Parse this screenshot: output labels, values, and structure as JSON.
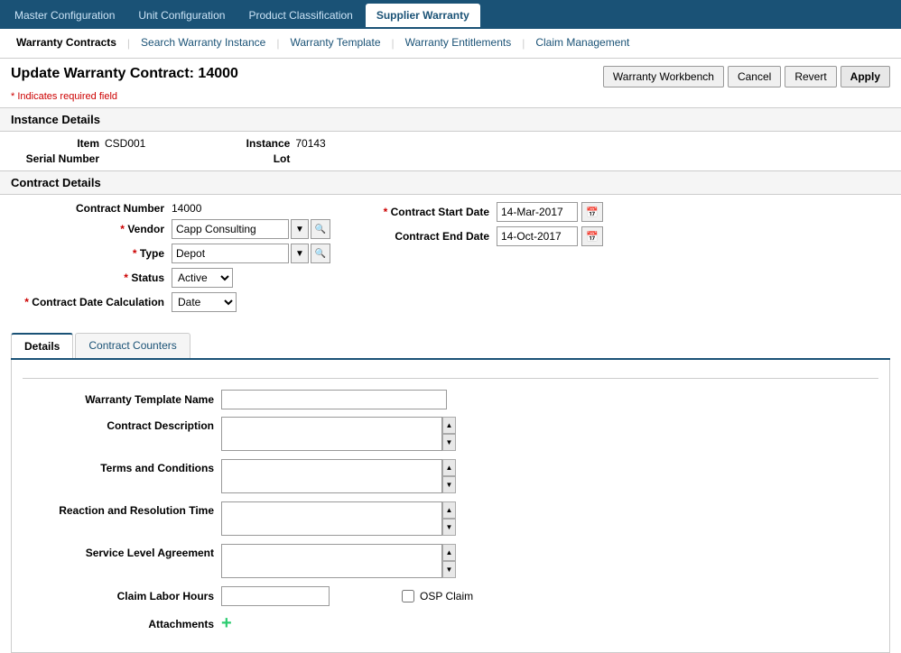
{
  "topNav": {
    "tabs": [
      {
        "id": "master-config",
        "label": "Master Configuration",
        "active": false
      },
      {
        "id": "unit-config",
        "label": "Unit Configuration",
        "active": false
      },
      {
        "id": "product-class",
        "label": "Product Classification",
        "active": false
      },
      {
        "id": "supplier-warranty",
        "label": "Supplier Warranty",
        "active": true
      }
    ]
  },
  "secondNav": {
    "items": [
      {
        "id": "warranty-contracts",
        "label": "Warranty Contracts",
        "active": true
      },
      {
        "id": "search-warranty",
        "label": "Search Warranty Instance",
        "active": false
      },
      {
        "id": "warranty-template",
        "label": "Warranty Template",
        "active": false
      },
      {
        "id": "warranty-entitlements",
        "label": "Warranty Entitlements",
        "active": false
      },
      {
        "id": "claim-management",
        "label": "Claim Management",
        "active": false
      }
    ]
  },
  "pageTitle": "Update Warranty Contract: 14000",
  "requiredNote": "* Indicates required field",
  "actionButtons": {
    "warrantyWorkbench": "Warranty Workbench",
    "cancel": "Cancel",
    "revert": "Revert",
    "apply": "Apply"
  },
  "instanceDetails": {
    "sectionTitle": "Instance Details",
    "item": {
      "label": "Item",
      "value": "CSD001"
    },
    "serialNumber": {
      "label": "Serial Number",
      "value": ""
    },
    "instance": {
      "label": "Instance",
      "value": "70143"
    },
    "lot": {
      "label": "Lot",
      "value": ""
    }
  },
  "contractDetails": {
    "sectionTitle": "Contract Details",
    "contractNumber": {
      "label": "Contract Number",
      "value": "14000"
    },
    "vendor": {
      "label": "Vendor",
      "value": "Capp Consulting",
      "required": true
    },
    "type": {
      "label": "Type",
      "value": "Depot",
      "required": true
    },
    "status": {
      "label": "Status",
      "value": "Active",
      "required": true
    },
    "contractDateCalc": {
      "label": "Contract Date Calculation",
      "value": "Date",
      "required": true
    },
    "contractStartDate": {
      "label": "Contract Start Date",
      "value": "14-Mar-2017",
      "required": true
    },
    "contractEndDate": {
      "label": "Contract End Date",
      "value": "14-Oct-2017",
      "required": false
    }
  },
  "innerTabs": {
    "tabs": [
      {
        "id": "details",
        "label": "Details",
        "active": true
      },
      {
        "id": "contract-counters",
        "label": "Contract Counters",
        "active": false
      }
    ]
  },
  "detailsTab": {
    "warrantyTemplateName": {
      "label": "Warranty Template Name",
      "value": ""
    },
    "contractDescription": {
      "label": "Contract Description",
      "value": ""
    },
    "termsAndConditions": {
      "label": "Terms and Conditions",
      "value": ""
    },
    "reactionResolutionTime": {
      "label": "Reaction and Resolution Time",
      "value": ""
    },
    "serviceLevelAgreement": {
      "label": "Service Level Agreement",
      "value": ""
    },
    "claimLaborHours": {
      "label": "Claim Labor Hours",
      "value": ""
    },
    "ospClaim": {
      "label": "OSP Claim",
      "checked": false
    },
    "attachments": {
      "label": "Attachments"
    }
  }
}
